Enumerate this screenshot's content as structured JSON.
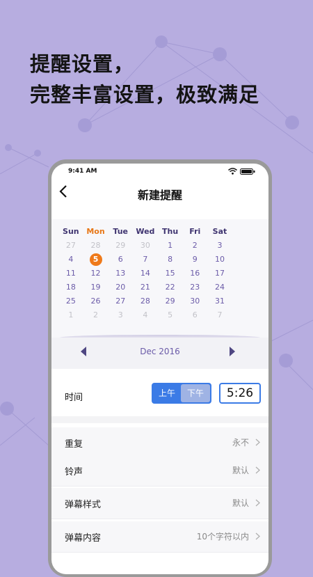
{
  "headline": {
    "line1": "提醒设置，",
    "line2": "完整丰富设置，极致满足"
  },
  "status_bar": {
    "time": "9:41 AM"
  },
  "nav": {
    "title": "新建提醒"
  },
  "calendar": {
    "weekdays": [
      "Sun",
      "Mon",
      "Tue",
      "Wed",
      "Thu",
      "Fri",
      "Sat"
    ],
    "today_weekday_index": 1,
    "selected_day": "5",
    "weeks": [
      [
        {
          "d": "27",
          "dim": true
        },
        {
          "d": "28",
          "dim": true
        },
        {
          "d": "29",
          "dim": true
        },
        {
          "d": "30",
          "dim": true
        },
        {
          "d": "1"
        },
        {
          "d": "2"
        },
        {
          "d": "3"
        }
      ],
      [
        {
          "d": "4"
        },
        {
          "d": "5",
          "sel": true
        },
        {
          "d": "6"
        },
        {
          "d": "7"
        },
        {
          "d": "8"
        },
        {
          "d": "9"
        },
        {
          "d": "10"
        }
      ],
      [
        {
          "d": "11"
        },
        {
          "d": "12"
        },
        {
          "d": "13"
        },
        {
          "d": "14"
        },
        {
          "d": "15"
        },
        {
          "d": "16"
        },
        {
          "d": "17"
        }
      ],
      [
        {
          "d": "18"
        },
        {
          "d": "19"
        },
        {
          "d": "20"
        },
        {
          "d": "21"
        },
        {
          "d": "22"
        },
        {
          "d": "23"
        },
        {
          "d": "24"
        }
      ],
      [
        {
          "d": "25"
        },
        {
          "d": "26"
        },
        {
          "d": "27"
        },
        {
          "d": "28"
        },
        {
          "d": "29"
        },
        {
          "d": "30"
        },
        {
          "d": "31"
        }
      ],
      [
        {
          "d": "1",
          "dim": true
        },
        {
          "d": "2",
          "dim": true
        },
        {
          "d": "3",
          "dim": true
        },
        {
          "d": "4",
          "dim": true
        },
        {
          "d": "5",
          "dim": true
        },
        {
          "d": "6",
          "dim": true
        },
        {
          "d": "7",
          "dim": true
        }
      ]
    ],
    "month_label": "Dec 2016"
  },
  "time_setting": {
    "label": "时间",
    "am": "上午",
    "pm": "下午",
    "selected": "pm",
    "value": "5:26"
  },
  "settings": [
    {
      "label": "重复",
      "value": "永不"
    },
    {
      "label": "铃声",
      "value": "默认"
    },
    {
      "label": "弹幕样式",
      "value": "默认"
    },
    {
      "label": "弹幕内容",
      "value": "10个字符以内"
    }
  ],
  "colors": {
    "background": "#b7ade0",
    "accent_blue": "#3b7be6",
    "today_orange": "#ef7a1a",
    "calendar_text": "#6b5ba8"
  },
  "icons": [
    "back-icon",
    "wifi-icon",
    "battery-icon",
    "arrow-left-icon",
    "arrow-right-icon",
    "chevron-right-icon"
  ]
}
